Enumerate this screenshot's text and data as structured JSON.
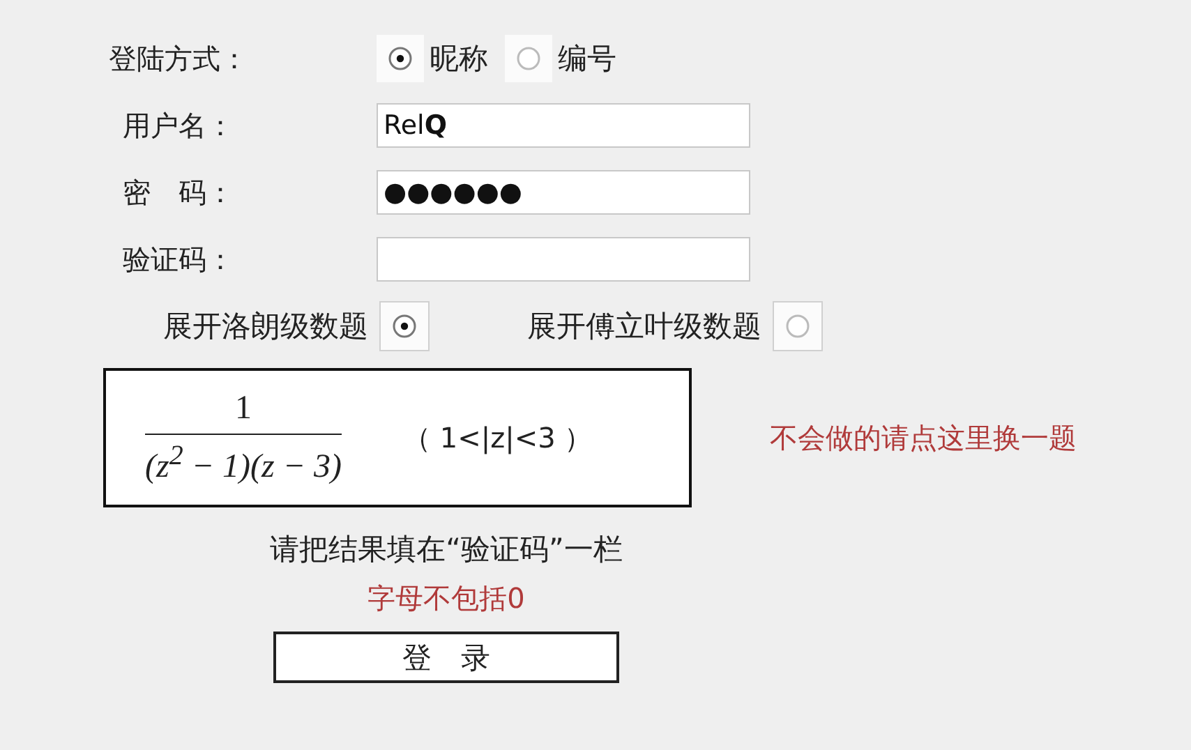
{
  "login_mode": {
    "label": "登陆方式：",
    "options": [
      {
        "label": "昵称",
        "selected": true
      },
      {
        "label": "编号",
        "selected": false
      }
    ]
  },
  "fields": [
    {
      "label": "用户名：",
      "value": "Rel**Q**"
    },
    {
      "label": "密　码：",
      "value": "●●●●●●"
    },
    {
      "label": "验证码："
    }
  ],
  "series_options": [
    {
      "label": "展开洛朗级数题",
      "selected": true
    },
    {
      "label": "展开傅立叶级数题",
      "selected": false
    }
  ],
  "problem": {
    "numerator": "1",
    "denominator": "(z$^{2}$ − 1)(z − 3)",
    "condition": "（ 1<|z|<3 ）"
  },
  "skip_link": "不会做的请点这里换一题",
  "instruction": "请把结果填在“验证码”一栏",
  "note": "字母不包括0",
  "login_button": "登　录"
}
